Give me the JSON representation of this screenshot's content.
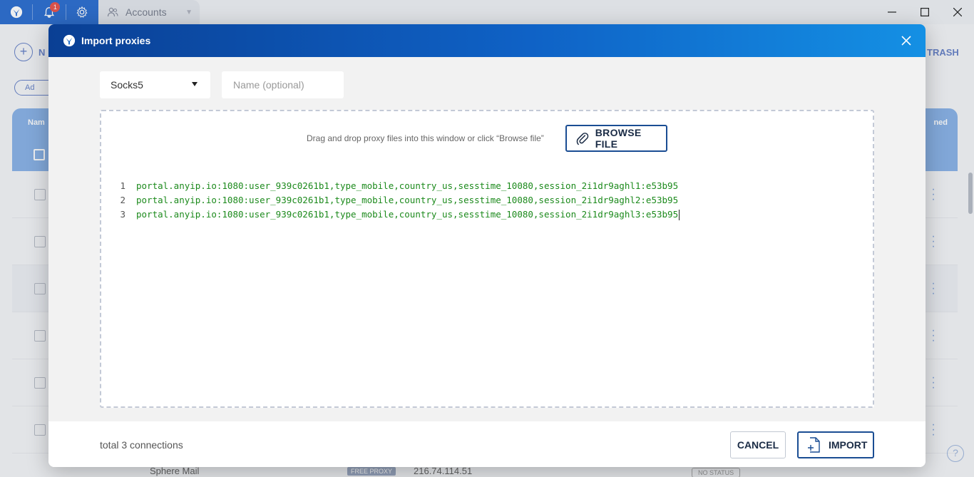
{
  "app": {
    "notifications_count": "1",
    "tab_label": "Accounts",
    "bg_new_label": "N",
    "bg_trash_label": "TRASH",
    "bg_add_label": "Ad",
    "bg_header_name": "Nam",
    "bg_header_right": "ned",
    "bg_last_row": {
      "name": "Sphere Mail",
      "proxy_badge": "FREE PROXY",
      "ip": "216.74.114.51",
      "status": "NO STATUS"
    }
  },
  "modal": {
    "title": "Import proxies",
    "proxy_type": "Socks5",
    "name_placeholder": "Name (optional)",
    "drop_hint": "Drag and drop proxy files into this window or click “Browse file”",
    "browse_label": "BROWSE FILE",
    "lines": [
      {
        "num": "1",
        "text": "portal.anyip.io:1080:user_939c0261b1,type_mobile,country_us,sesstime_10080,session_2i1dr9aghl1:e53b95"
      },
      {
        "num": "2",
        "text": "portal.anyip.io:1080:user_939c0261b1,type_mobile,country_us,sesstime_10080,session_2i1dr9aghl2:e53b95"
      },
      {
        "num": "3",
        "text": "portal.anyip.io:1080:user_939c0261b1,type_mobile,country_us,sesstime_10080,session_2i1dr9aghl3:e53b95"
      }
    ],
    "total_text": "total 3 connections",
    "cancel_label": "CANCEL",
    "import_label": "IMPORT"
  },
  "colors": {
    "header_gradient_start": "#0a3f94",
    "header_gradient_end": "#1490e4",
    "code_text": "#1c8a1c",
    "button_border": "#1a4d93"
  },
  "icons": {
    "app_logo": "app-logo-icon",
    "notifications": "bell-icon",
    "settings": "gear-icon",
    "accounts": "users-icon",
    "close": "close-icon",
    "browse": "paperclip-icon",
    "import": "file-plus-icon"
  }
}
